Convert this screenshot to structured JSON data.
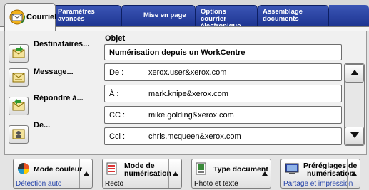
{
  "tabs": [
    {
      "label": "Courriel",
      "active": true
    },
    {
      "label": "Paramètres avancés",
      "lines": [
        "Paramètres",
        "avancés"
      ]
    },
    {
      "label": "Mise en page"
    },
    {
      "label": "Options courrier électronique",
      "lines": [
        "Options courrier",
        "électronique"
      ]
    },
    {
      "label": "Assemblage documents",
      "lines": [
        "Assemblage",
        "documents"
      ]
    }
  ],
  "side_buttons": [
    {
      "label": "Destinataires...",
      "icon": "envelope-arrow-icon"
    },
    {
      "label": "Message...",
      "icon": "message-envelope-icon"
    },
    {
      "label": "Répondre à...",
      "icon": "reply-envelope-icon"
    },
    {
      "label": "De...",
      "icon": "sender-card-icon"
    }
  ],
  "subject": {
    "label": "Objet",
    "value": "Numérisation depuis un WorkCentre"
  },
  "addresses": [
    {
      "type": "De :",
      "email": "xerox.user&xerox.com"
    },
    {
      "type": "À :",
      "email": "mark.knipe&xerox.com"
    },
    {
      "type": "CC :",
      "email": "mike.golding&xerox.com"
    },
    {
      "type": "Cci :",
      "email": "chris.mcqueen&xerox.com"
    }
  ],
  "features": [
    {
      "title_lines": [
        "Mode couleur"
      ],
      "value": "Détection auto",
      "value_color": "#1f3fa8",
      "icon": "color-wheel-icon"
    },
    {
      "title_lines": [
        "Mode de",
        "numérisation"
      ],
      "value": "Recto",
      "value_color": "#000000",
      "icon": "scan-mode-icon"
    },
    {
      "title_lines": [
        "Type document"
      ],
      "value": "Photo et texte",
      "value_color": "#000000",
      "icon": "document-type-icon"
    },
    {
      "title_lines": [
        "Préréglages de",
        "numérisation"
      ],
      "value": "Partage et impression",
      "value_color": "#1f3fa8",
      "icon": "scan-preset-icon"
    }
  ],
  "colors": {
    "tab_blue": "#2a44a6",
    "accent_blue": "#1f3fa8"
  }
}
